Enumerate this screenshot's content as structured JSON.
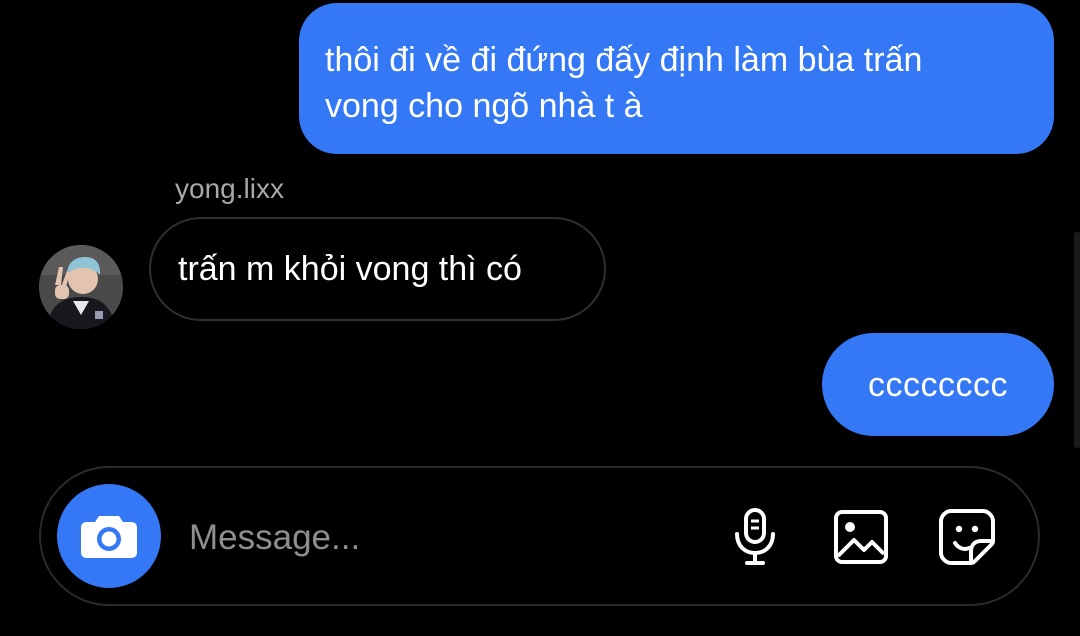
{
  "messages": [
    {
      "direction": "outgoing",
      "lines": [
        "thôi đi về đi đứng đấy định làm bùa trấn",
        "vong cho ngõ nhà t à"
      ]
    },
    {
      "direction": "incoming",
      "sender": "yong.lixx",
      "text": "trấn m khỏi vong thì có"
    },
    {
      "direction": "outgoing",
      "text": "cccccccc"
    }
  ],
  "composer": {
    "placeholder": "Message..."
  },
  "icons": {
    "camera": "camera-icon",
    "microphone": "microphone-icon",
    "gallery": "gallery-icon",
    "sticker": "sticker-icon"
  },
  "colors": {
    "background": "#000000",
    "outgoing_bubble": "#3478f6",
    "incoming_border": "#2f2f2f",
    "sender_name": "#a8a8a8",
    "placeholder": "#8e8e8e"
  }
}
